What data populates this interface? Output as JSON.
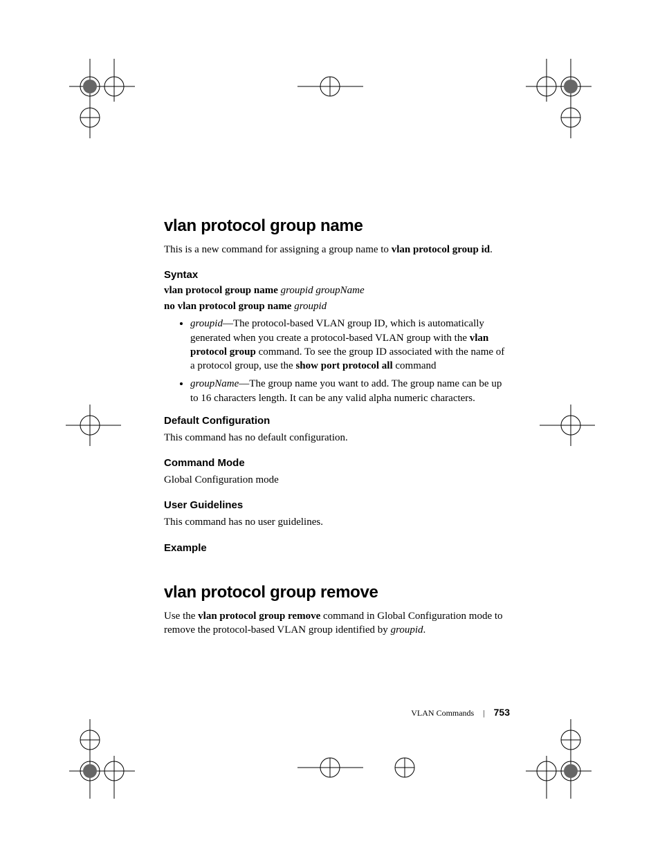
{
  "section1": {
    "title": "vlan protocol group name",
    "intro_pre": "This is a new command for assigning a group name to ",
    "intro_bold": "vlan protocol group id",
    "intro_post": ".",
    "syntax_heading": "Syntax",
    "syntax1_bold": "vlan protocol group name",
    "syntax1_ital": "groupid  groupName",
    "syntax2_bold": "no vlan protocol group name",
    "syntax2_ital": "groupid",
    "params": [
      {
        "term": "groupid",
        "text_a": "—The protocol-based VLAN group ID, which is automatically generated when you create a protocol-based VLAN group with the ",
        "bold_a": "vlan protocol group",
        "text_b": " command. To see the group ID associated with the name of a protocol group, use the ",
        "bold_b": "show port protocol all",
        "text_c": " command"
      },
      {
        "term": "groupName",
        "text_a": "—The group name you want to add. The group name can be up to 16 characters length. It can be any valid alpha numeric characters.",
        "bold_a": "",
        "text_b": "",
        "bold_b": "",
        "text_c": ""
      }
    ],
    "default_cfg_heading": "Default Configuration",
    "default_cfg_body": "This command has no default configuration.",
    "cmd_mode_heading": "Command Mode",
    "cmd_mode_body": "Global Configuration mode",
    "user_guide_heading": "User Guidelines",
    "user_guide_body": "This command has no user guidelines.",
    "example_heading": "Example"
  },
  "section2": {
    "title": "vlan protocol group remove",
    "intro_pre": "Use the ",
    "intro_bold": "vlan protocol group remove",
    "intro_mid": " command in Global Configuration mode to remove the protocol-based VLAN group identified by ",
    "intro_ital": "groupid",
    "intro_post": "."
  },
  "footer": {
    "chapter": "VLAN Commands",
    "page_number": "753"
  }
}
